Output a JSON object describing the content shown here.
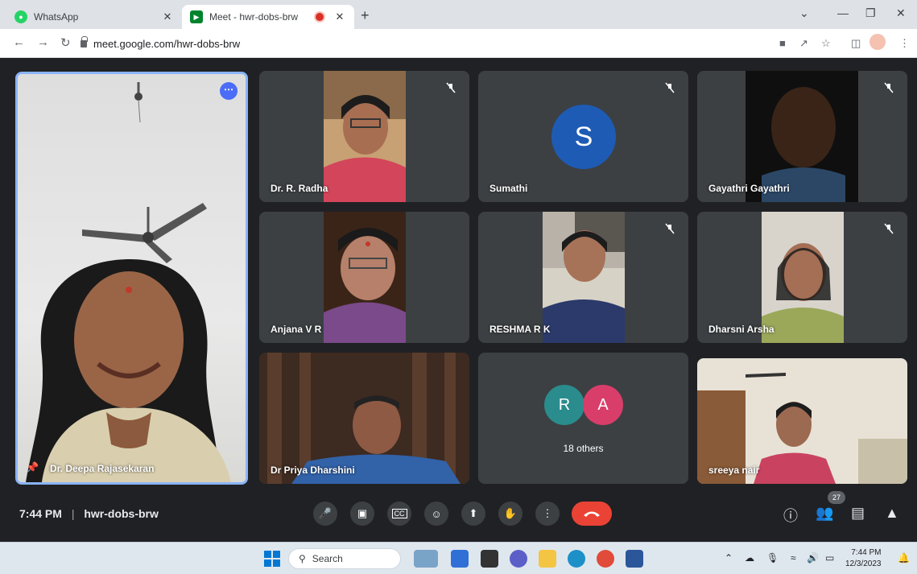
{
  "browser": {
    "tabs": [
      {
        "title": "WhatsApp",
        "icon": "whatsapp-icon",
        "color": "#25d366"
      },
      {
        "title": "Meet - hwr-dobs-brw",
        "icon": "meet-icon",
        "color": "#00832d"
      }
    ],
    "url": "meet.google.com/hwr-dobs-brw"
  },
  "meet": {
    "main_participant": "Dr. Deepa Rajasekaran",
    "participants": [
      {
        "name": "Dr. R. Radha",
        "muted": true
      },
      {
        "name": "Sumathi",
        "avatar_letter": "S",
        "avatar_color": "#1e5bb5",
        "muted": true
      },
      {
        "name": "Gayathri Gayathri",
        "muted": true
      },
      {
        "name": "Anjana V R",
        "muted": false
      },
      {
        "name": "RESHMA R K",
        "muted": true
      },
      {
        "name": "Dharsni Arsha",
        "muted": true
      },
      {
        "name": "Dr Priya Dharshini",
        "muted": false
      },
      {
        "name": "sreeya nair",
        "muted": false
      }
    ],
    "others": {
      "avatars": [
        {
          "letter": "R",
          "color": "#2a8c8c"
        },
        {
          "letter": "A",
          "color": "#d93e6b"
        }
      ],
      "label": "18 others"
    },
    "time": "7:44 PM",
    "meeting_code": "hwr-dobs-brw",
    "participant_count": "27"
  },
  "taskbar": {
    "search_placeholder": "Search",
    "time": "7:44 PM",
    "date": "12/3/2023"
  },
  "colors": {
    "accent": "#8ab4f8",
    "hangup": "#ea4335",
    "background": "#202124",
    "tile": "#3c4043"
  }
}
